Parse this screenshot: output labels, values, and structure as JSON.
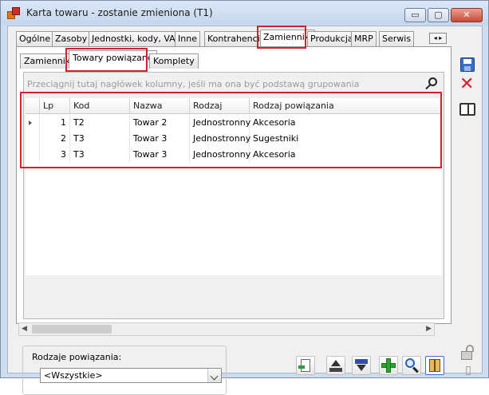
{
  "window": {
    "title": "Karta towaru - zostanie zmieniona (T1)",
    "controls": {
      "minimize": "▭",
      "maximize": "▢",
      "close": "✕"
    }
  },
  "main_tabs": [
    {
      "label": "Ogólne"
    },
    {
      "label": "Zasoby"
    },
    {
      "label": "Jednostki, kody, VAT"
    },
    {
      "label": "Inne"
    },
    {
      "label": "Kontrahenci"
    },
    {
      "label": "Zamienniki"
    },
    {
      "label": "Produkcja"
    },
    {
      "label": "MRP"
    },
    {
      "label": "Serwis"
    }
  ],
  "main_tabs_scroll": "◂ ▸",
  "sub_tabs": [
    {
      "label": "Zamienniki"
    },
    {
      "label": "Towary powiązane"
    },
    {
      "label": "Komplety"
    }
  ],
  "grid": {
    "group_hint": "Przeciągnij tutaj nagłówek kolumny, jeśli ma ona być podstawą grupowania",
    "columns": [
      "Lp",
      "Kod",
      "Nazwa",
      "Rodzaj",
      "Rodzaj powiązania"
    ],
    "rows": [
      {
        "lp": "1",
        "kod": "T2",
        "nazwa": "Towar 2",
        "rodzaj": "Jednostronny",
        "rodzaj_powiazania": "Akcesoria"
      },
      {
        "lp": "2",
        "kod": "T3",
        "nazwa": "Towar 3",
        "rodzaj": "Jednostronny",
        "rodzaj_powiazania": "Sugestniki"
      },
      {
        "lp": "3",
        "kod": "T3",
        "nazwa": "Towar 3",
        "rodzaj": "Jednostronny",
        "rodzaj_powiazania": "Akcesoria"
      }
    ],
    "scroll_left": "◀",
    "scroll_right": "▶"
  },
  "filter": {
    "legend": "Rodzaje powiązania:",
    "selected": "<Wszystkie>"
  },
  "icons": {
    "side": [
      "save-icon",
      "delete-icon",
      "book-icon",
      "lock-icon",
      "pin-icon"
    ],
    "toolbar": [
      "export-icon",
      "upload-icon",
      "download-icon",
      "add-icon",
      "magnifier-icon",
      "columns-icon"
    ]
  },
  "colors": {
    "highlight_box": "#d3202f",
    "window_frame": "#cddcee"
  }
}
